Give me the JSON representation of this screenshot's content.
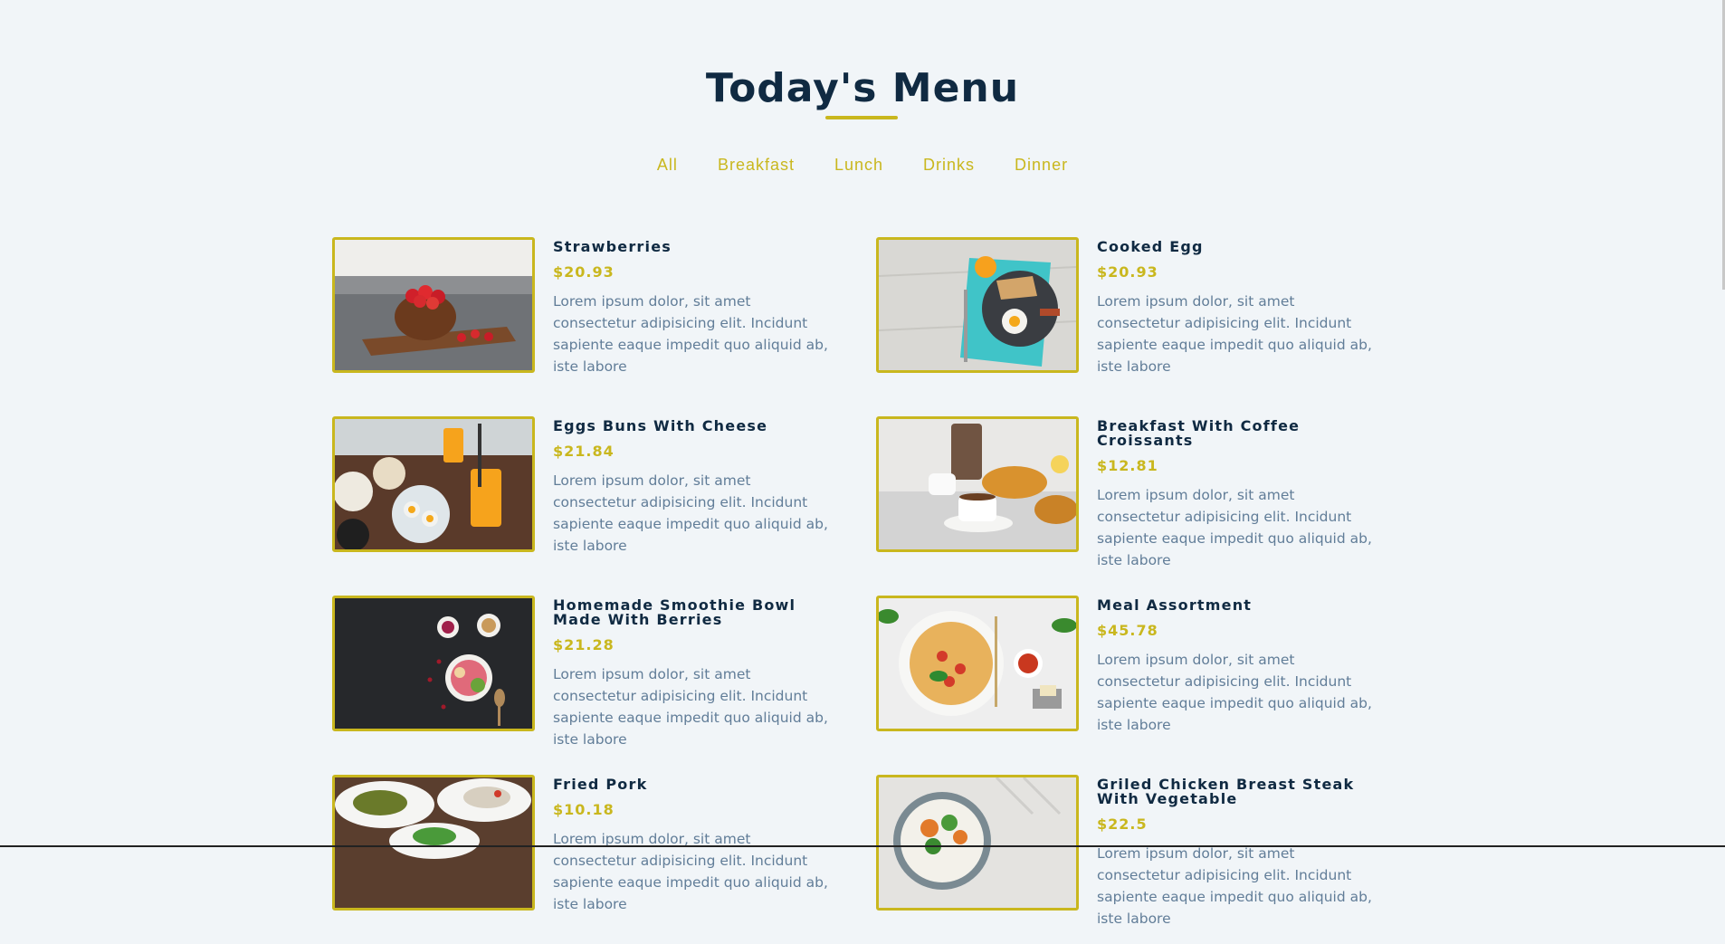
{
  "page": {
    "title": "Today's Menu"
  },
  "filters": [
    "All",
    "Breakfast",
    "Lunch",
    "Drinks",
    "Dinner"
  ],
  "colors": {
    "background": "#f1f5f8",
    "accent": "#c9b71e",
    "heading": "#102a42",
    "text": "#617d98"
  },
  "menu": [
    {
      "name": "Strawberries",
      "price": "$20.93",
      "desc": "Lorem ipsum dolor, sit amet consectetur adipisicing elit. Incidunt sapiente eaque impedit quo aliquid ab, iste labore",
      "image": "strawberries-photo"
    },
    {
      "name": "Cooked Egg",
      "price": "$20.93",
      "desc": "Lorem ipsum dolor, sit amet consectetur adipisicing elit. Incidunt sapiente eaque impedit quo aliquid ab, iste labore",
      "image": "cooked-egg-photo"
    },
    {
      "name": "Eggs Buns With Cheese",
      "price": "$21.84",
      "desc": "Lorem ipsum dolor, sit amet consectetur adipisicing elit. Incidunt sapiente eaque impedit quo aliquid ab, iste labore",
      "image": "eggs-buns-photo"
    },
    {
      "name": "Breakfast With Coffee Croissants",
      "price": "$12.81",
      "desc": "Lorem ipsum dolor, sit amet consectetur adipisicing elit. Incidunt sapiente eaque impedit quo aliquid ab, iste labore",
      "image": "coffee-croissants-photo"
    },
    {
      "name": "Homemade Smoothie Bowl Made With Berries",
      "price": "$21.28",
      "desc": "Lorem ipsum dolor, sit amet consectetur adipisicing elit. Incidunt sapiente eaque impedit quo aliquid ab, iste labore",
      "image": "smoothie-bowl-photo"
    },
    {
      "name": "Meal Assortment",
      "price": "$45.78",
      "desc": "Lorem ipsum dolor, sit amet consectetur adipisicing elit. Incidunt sapiente eaque impedit quo aliquid ab, iste labore",
      "image": "meal-assortment-photo"
    },
    {
      "name": "Fried Pork",
      "price": "$10.18",
      "desc": "Lorem ipsum dolor, sit amet consectetur adipisicing elit. Incidunt sapiente eaque impedit quo aliquid ab, iste labore",
      "image": "fried-pork-photo"
    },
    {
      "name": "Griled Chicken Breast Steak With Vegetable",
      "price": "$22.5",
      "desc": "Lorem ipsum dolor, sit amet consectetur adipisicing elit. Incidunt sapiente eaque impedit quo aliquid ab, iste labore",
      "image": "grilled-chicken-photo"
    }
  ]
}
